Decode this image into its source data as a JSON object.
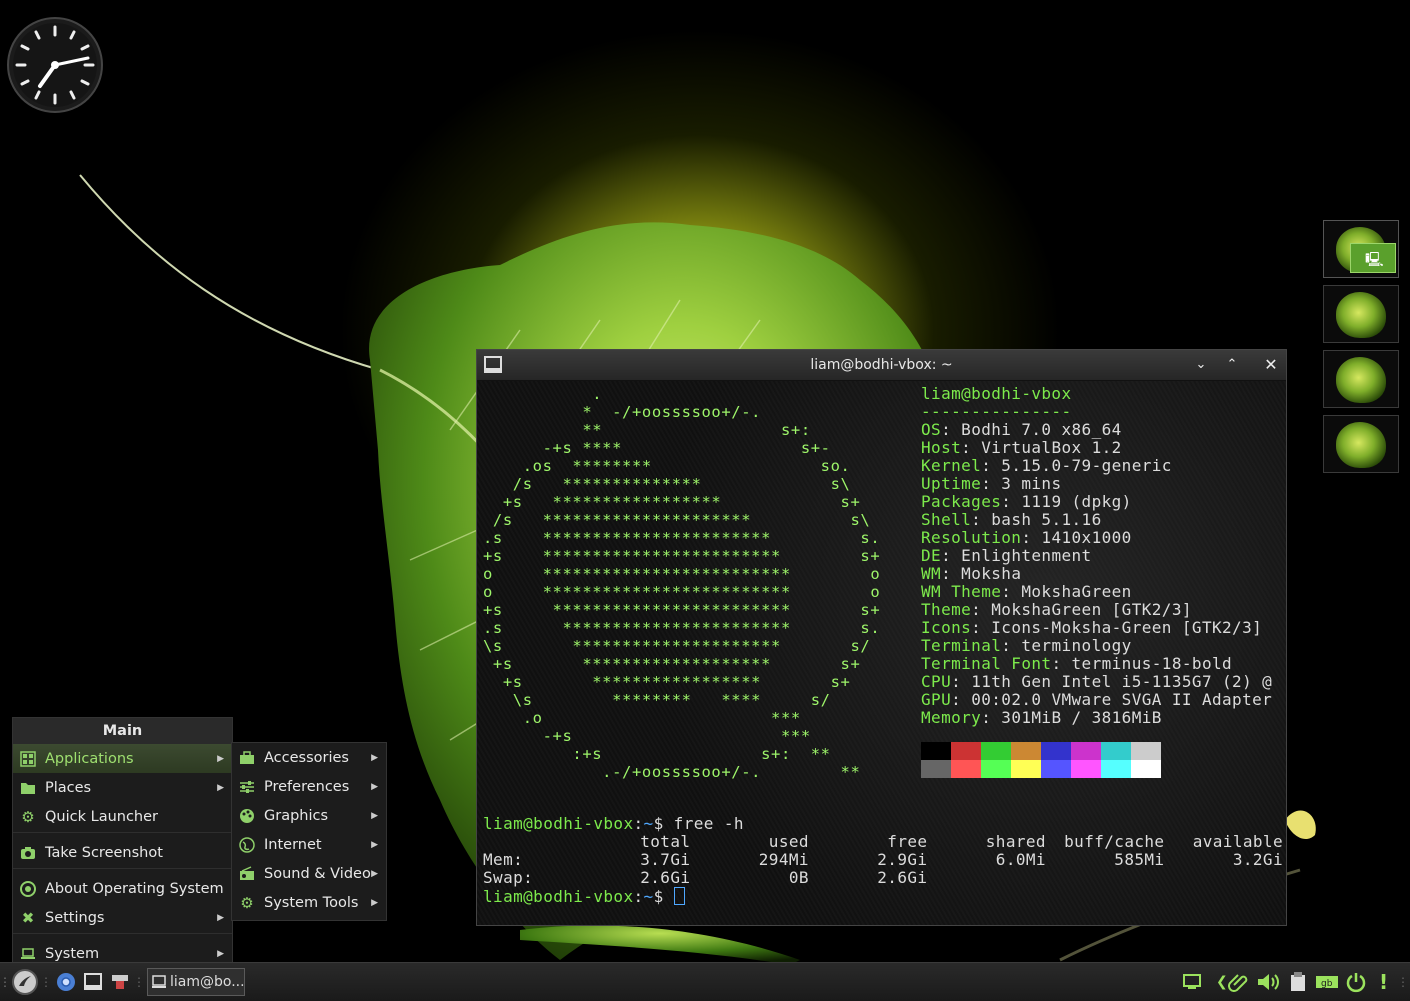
{
  "terminal": {
    "title": "liam@bodhi-vbox: ~",
    "neofetch": {
      "user_host": "liam@bodhi-vbox",
      "separator": "---------------",
      "rows": [
        {
          "key": "OS",
          "value": "Bodhi 7.0 x86_64"
        },
        {
          "key": "Host",
          "value": "VirtualBox 1.2"
        },
        {
          "key": "Kernel",
          "value": "5.15.0-79-generic"
        },
        {
          "key": "Uptime",
          "value": "3 mins"
        },
        {
          "key": "Packages",
          "value": "1119 (dpkg)"
        },
        {
          "key": "Shell",
          "value": "bash 5.1.16"
        },
        {
          "key": "Resolution",
          "value": "1410x1000"
        },
        {
          "key": "DE",
          "value": "Enlightenment"
        },
        {
          "key": "WM",
          "value": "Moksha"
        },
        {
          "key": "WM Theme",
          "value": "MokshaGreen"
        },
        {
          "key": "Theme",
          "value": "MokshaGreen [GTK2/3]"
        },
        {
          "key": "Icons",
          "value": "Icons-Moksha-Green [GTK2/3]"
        },
        {
          "key": "Terminal",
          "value": "terminology"
        },
        {
          "key": "Terminal Font",
          "value": "terminus-18-bold"
        },
        {
          "key": "CPU",
          "value": "11th Gen Intel i5-1135G7 (2) @"
        },
        {
          "key": "GPU",
          "value": "00:02.0 VMware SVGA II Adapter"
        },
        {
          "key": "Memory",
          "value": "301MiB / 3816MiB"
        }
      ],
      "palette_dark": [
        "#000000",
        "#cc3333",
        "#33cc33",
        "#cc8833",
        "#3333cc",
        "#cc33cc",
        "#33cccc",
        "#cccccc"
      ],
      "palette_bright": [
        "#666666",
        "#ff5555",
        "#55ff55",
        "#ffff55",
        "#5555ff",
        "#ff55ff",
        "#55ffff",
        "#ffffff"
      ],
      "ascii": [
        "           .",
        "          *  -/+oossssoo+/-.",
        "          **                  s+:",
        "      -+s ****                  s+-",
        "    .os  ********                 so.",
        "   /s   **************             s\\",
        "  +s   *****************            s+",
        " /s   *********************          s\\",
        ".s    ***********************         s.",
        "+s    ************************        s+",
        "o     *************************        o",
        "o     *************************        o",
        "+s     ************************       s+",
        ".s      ***********************       s.",
        "\\s       *********************       s/",
        " +s       *******************       s+",
        "  +s       *****************       s+",
        "   \\s        ********   ****     s/",
        "    .o                       ***",
        "      -+s                     ***",
        "         :+s                s+:  **",
        "            .-/+oossssoo+/-.        **"
      ]
    },
    "command1": {
      "user": "liam@bodhi-vbox",
      "path": "~",
      "symbol": "$",
      "command": " free -h"
    },
    "free": {
      "headers": [
        "",
        "total",
        "used",
        "free",
        "shared",
        "buff/cache",
        "available"
      ],
      "rows": [
        [
          "Mem:",
          "3.7Gi",
          "294Mi",
          "2.9Gi",
          "6.0Mi",
          "585Mi",
          "3.2Gi"
        ],
        [
          "Swap:",
          "2.6Gi",
          "0B",
          "2.6Gi",
          "",
          "",
          ""
        ]
      ]
    },
    "command2": {
      "user": "liam@bodhi-vbox",
      "path": "~",
      "symbol": "$"
    }
  },
  "main_menu": {
    "title": "Main",
    "items": [
      {
        "label": "Applications",
        "icon": "apps-grid-icon"
      },
      {
        "label": "Places",
        "icon": "folder-icon"
      },
      {
        "label": "Quick Launcher",
        "icon": "gear-icon"
      },
      {
        "label": "Take Screenshot",
        "icon": "camera-icon"
      },
      {
        "label": "About Operating System",
        "icon": "info-icon"
      },
      {
        "label": "Settings",
        "icon": "tools-icon"
      },
      {
        "label": "System",
        "icon": "laptop-icon"
      }
    ]
  },
  "apps_submenu": {
    "items": [
      {
        "label": "Accessories",
        "icon": "briefcase-icon"
      },
      {
        "label": "Preferences",
        "icon": "sliders-icon"
      },
      {
        "label": "Graphics",
        "icon": "palette-icon"
      },
      {
        "label": "Internet",
        "icon": "globe-icon"
      },
      {
        "label": "Sound & Video",
        "icon": "radio-icon"
      },
      {
        "label": "System Tools",
        "icon": "gear-icon"
      }
    ]
  },
  "taskbar": {
    "task_label": "liam@bo..."
  },
  "colors": {
    "accent_green": "#7dea4c",
    "prompt_blue": "#4fa8ff",
    "menu_highlight": "#9fe070"
  }
}
